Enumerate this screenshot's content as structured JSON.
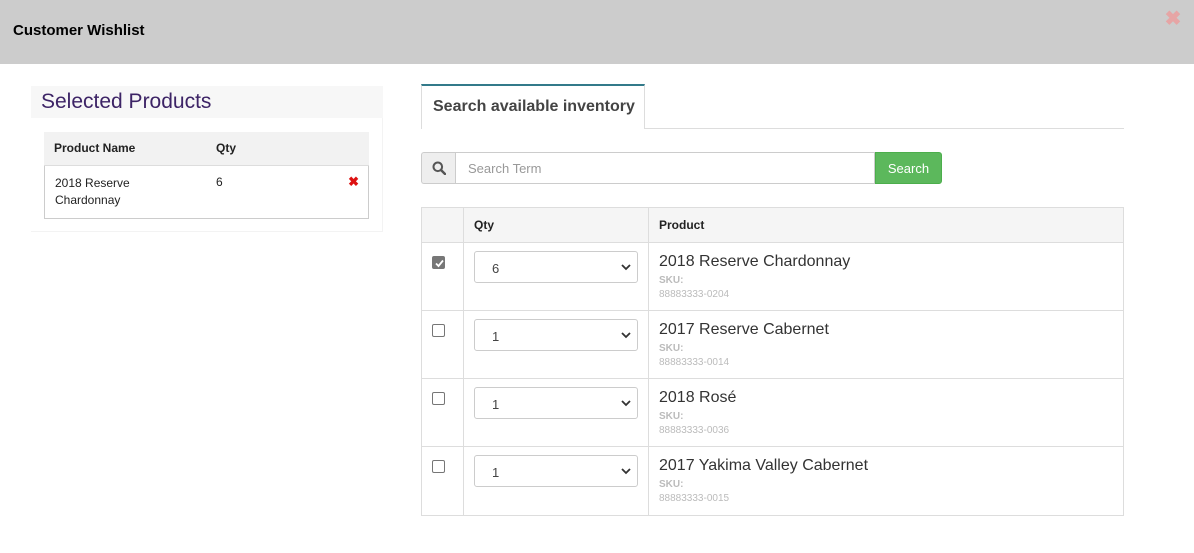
{
  "modal": {
    "title": "Customer Wishlist",
    "close_glyph": "✖"
  },
  "selected": {
    "title": "Selected Products",
    "headers": {
      "name": "Product Name",
      "qty": "Qty"
    },
    "rows": [
      {
        "name": "2018 Reserve Chardonnay",
        "qty": "6",
        "remove_glyph": "✖"
      }
    ]
  },
  "tabs": [
    {
      "label": "Search available inventory",
      "active": true
    }
  ],
  "search": {
    "icon": "search-icon",
    "placeholder": "Search Term",
    "value": "",
    "button_label": "Search"
  },
  "inventory": {
    "headers": {
      "select": "",
      "qty": "Qty",
      "product": "Product"
    },
    "rows": [
      {
        "checked": true,
        "qty": "6",
        "name": "2018 Reserve Chardonnay",
        "sku_label": "SKU:",
        "sku": "88883333-0204"
      },
      {
        "checked": false,
        "qty": "1",
        "name": "2017 Reserve Cabernet",
        "sku_label": "SKU:",
        "sku": "88883333-0014"
      },
      {
        "checked": false,
        "qty": "1",
        "name": "2018 Rosé",
        "sku_label": "SKU:",
        "sku": "88883333-0036"
      },
      {
        "checked": false,
        "qty": "1",
        "name": "2017 Yakima Valley Cabernet",
        "sku_label": "SKU:",
        "sku": "88883333-0015"
      }
    ]
  },
  "colors": {
    "header_bg": "#cccccc",
    "title_purple": "#3d2466",
    "search_green": "#5cb85c",
    "remove_red": "#dd1111",
    "tab_accent": "#337a8a"
  }
}
